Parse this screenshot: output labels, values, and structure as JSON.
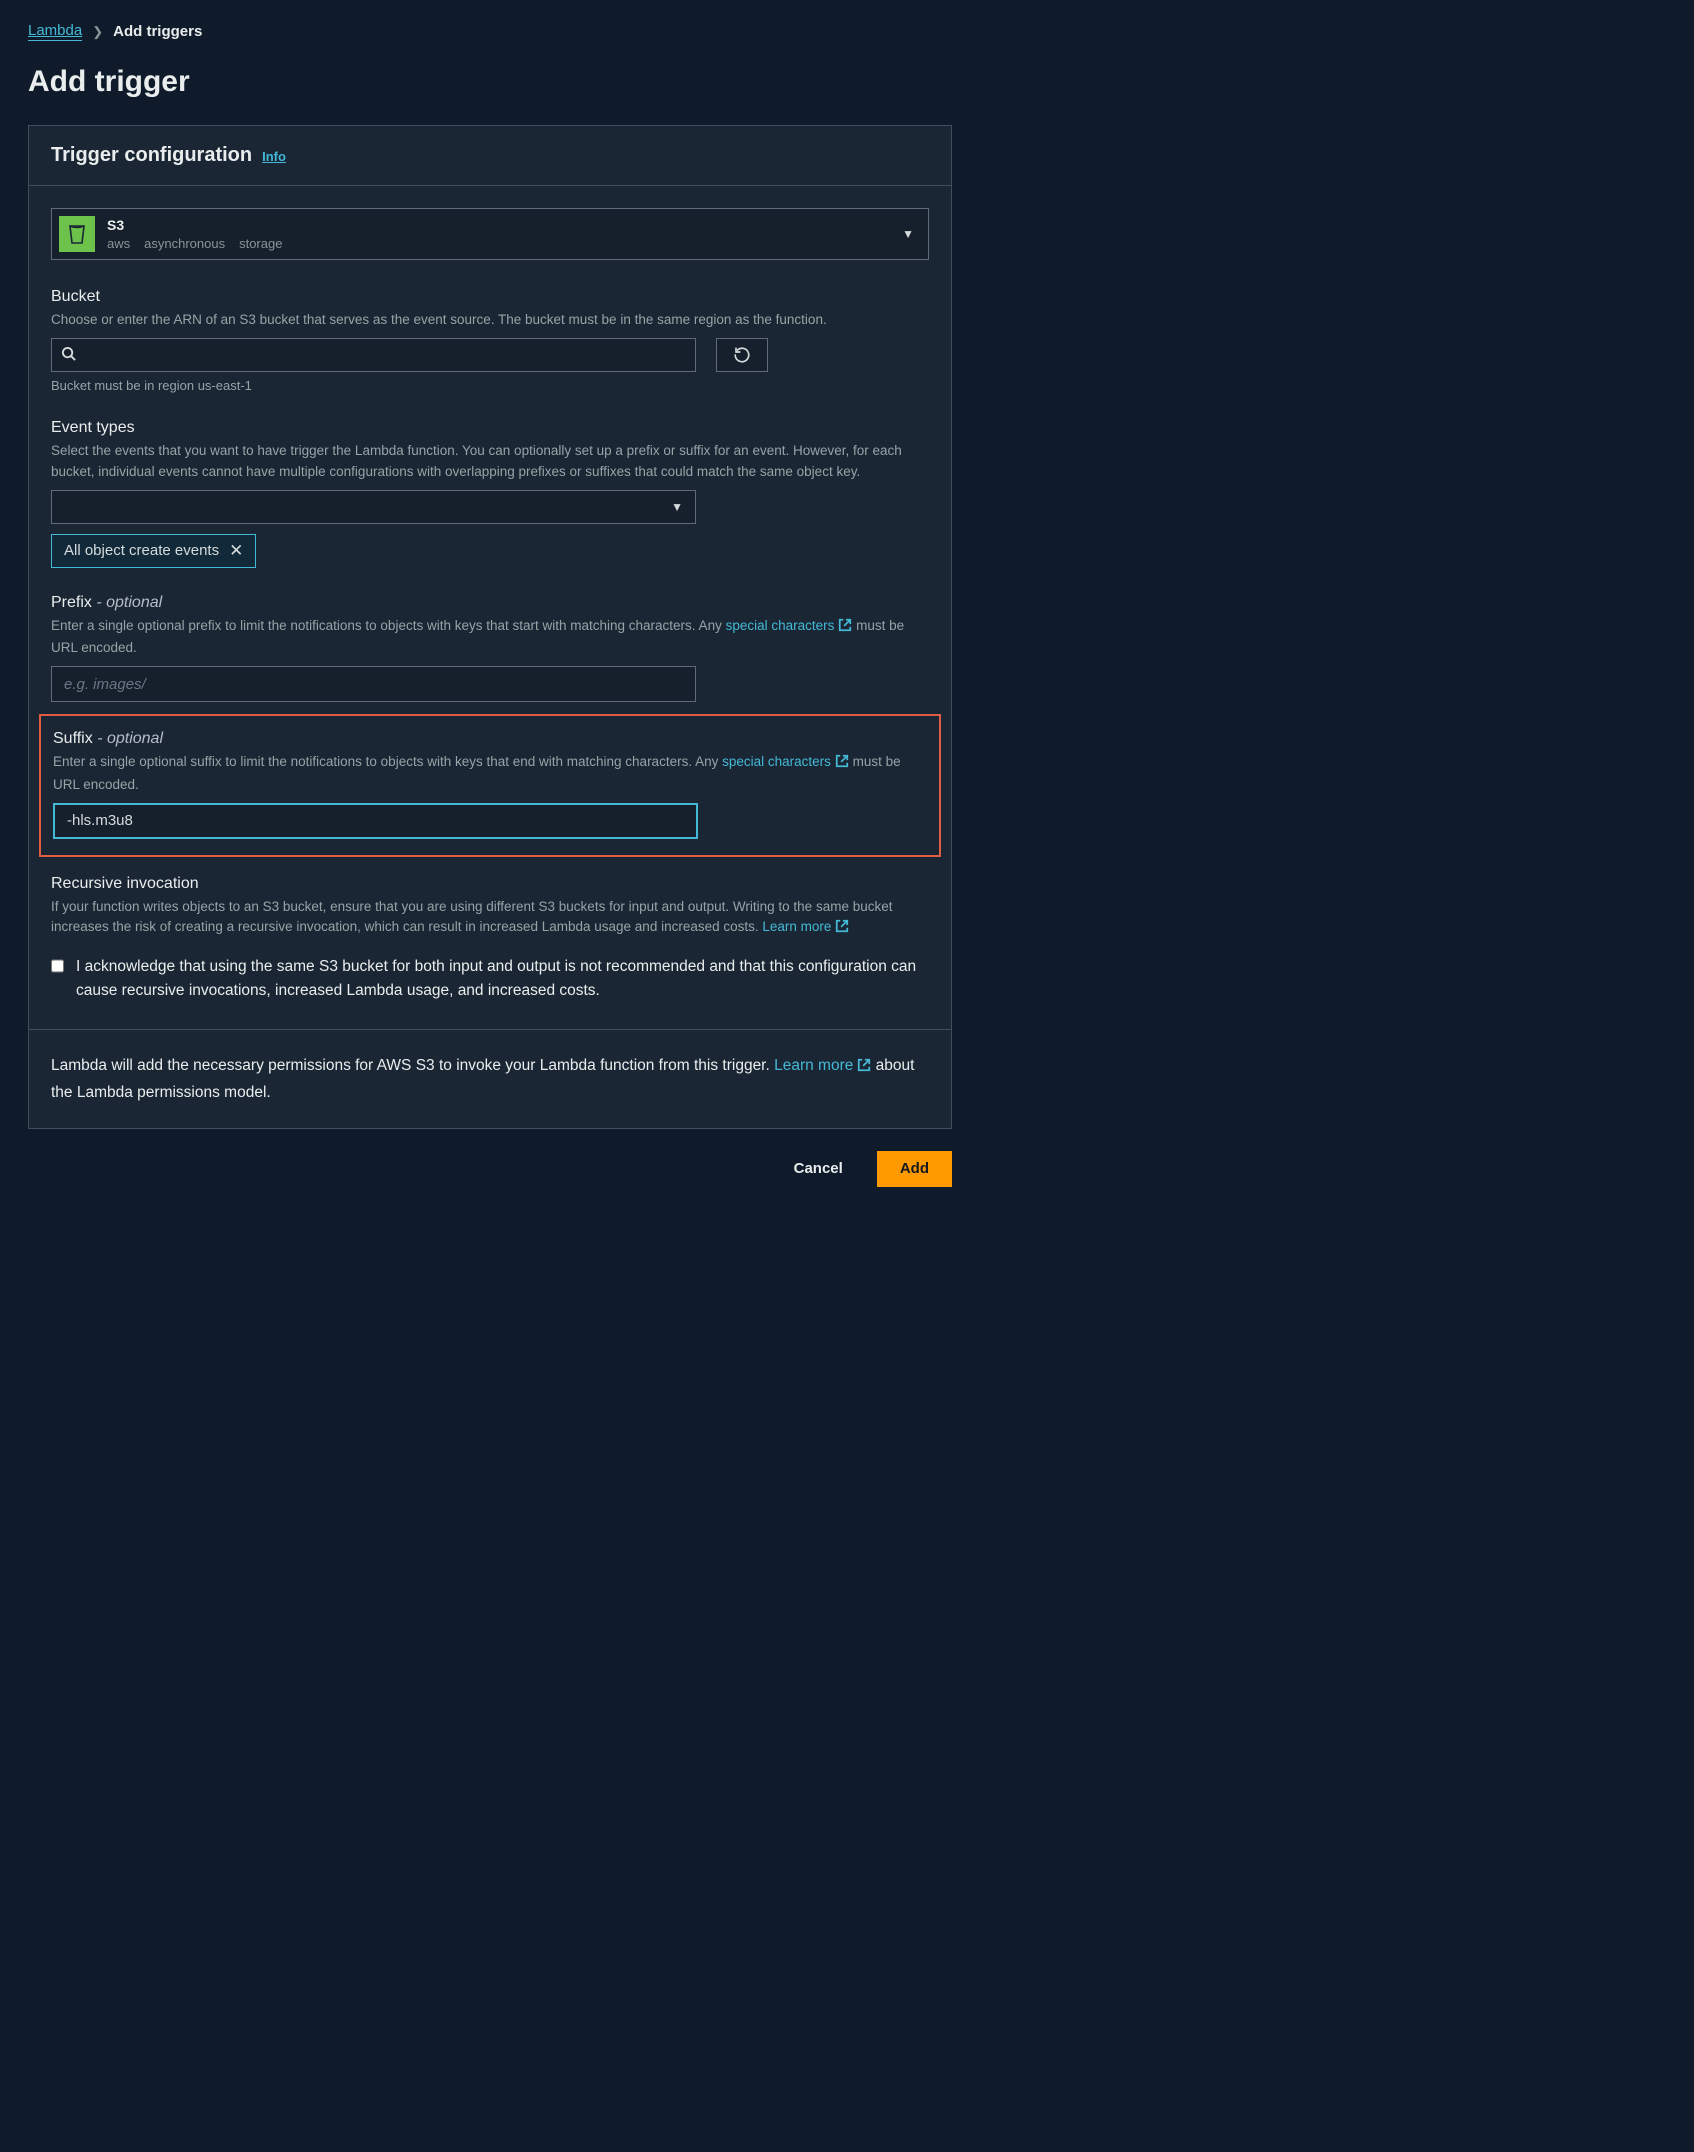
{
  "breadcrumb": {
    "root": "Lambda",
    "current": "Add triggers"
  },
  "page_title": "Add trigger",
  "panel": {
    "title": "Trigger configuration",
    "info": "Info"
  },
  "source": {
    "title": "S3",
    "tags": [
      "aws",
      "asynchronous",
      "storage"
    ]
  },
  "bucket": {
    "label": "Bucket",
    "desc": "Choose or enter the ARN of an S3 bucket that serves as the event source. The bucket must be in the same region as the function.",
    "hint": "Bucket must be in region us-east-1",
    "search_placeholder": ""
  },
  "event_types": {
    "label": "Event types",
    "desc": "Select the events that you want to have trigger the Lambda function. You can optionally set up a prefix or suffix for an event. However, for each bucket, individual events cannot have multiple configurations with overlapping prefixes or suffixes that could match the same object key.",
    "selected_chip": "All object create events"
  },
  "prefix": {
    "label": "Prefix",
    "optional": "- optional",
    "desc_pre": "Enter a single optional prefix to limit the notifications to objects with keys that start with matching characters. Any ",
    "special_link": "special characters",
    "desc_post": " must be URL encoded.",
    "placeholder": "e.g. images/",
    "value": ""
  },
  "suffix": {
    "label": "Suffix",
    "optional": "- optional",
    "desc_pre": "Enter a single optional suffix to limit the notifications to objects with keys that end with matching characters. Any ",
    "special_link": "special characters",
    "desc_post": " must be URL encoded.",
    "value": "-hls.m3u8"
  },
  "recursive": {
    "label": "Recursive invocation",
    "desc_pre": "If your function writes objects to an S3 bucket, ensure that you are using different S3 buckets for input and output. Writing to the same bucket increases the risk of creating a recursive invocation, which can result in increased Lambda usage and increased costs. ",
    "learn_more": "Learn more",
    "ack": "I acknowledge that using the same S3 bucket for both input and output is not recommended and that this configuration can cause recursive invocations, increased Lambda usage, and increased costs."
  },
  "permissions": {
    "note_pre": "Lambda will add the necessary permissions for AWS S3 to invoke your Lambda function from this trigger. ",
    "learn_more": "Learn more",
    "note_post": " about the Lambda permissions model."
  },
  "buttons": {
    "cancel": "Cancel",
    "add": "Add"
  }
}
